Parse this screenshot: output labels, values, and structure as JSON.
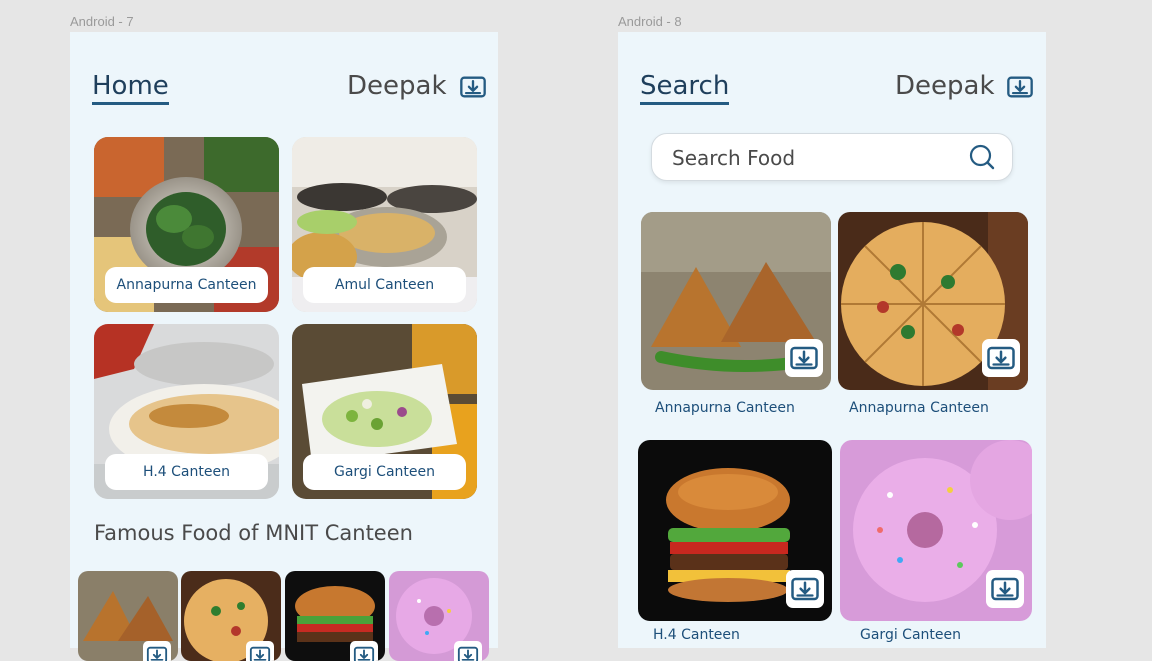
{
  "frames": {
    "left_label": "Android - 7",
    "right_label": "Android - 8"
  },
  "home": {
    "title": "Home",
    "user": "Deepak",
    "icon": "download-icon",
    "canteens": [
      {
        "label": "Annapurna Canteen",
        "image": "food-platter"
      },
      {
        "label": "Amul Canteen",
        "image": "buffet-trays"
      },
      {
        "label": "H.4 Canteen",
        "image": "baked-dish"
      },
      {
        "label": "Gargi Canteen",
        "image": "chopped-salad"
      }
    ],
    "section_title": "Famous Food of MNIT Canteen",
    "famous_foods": [
      {
        "image": "samosa"
      },
      {
        "image": "pizza"
      },
      {
        "image": "burger"
      },
      {
        "image": "donut"
      }
    ]
  },
  "search": {
    "title": "Search",
    "user": "Deepak",
    "icon": "download-icon",
    "placeholder": "Search Food",
    "results": [
      {
        "label": "Annapurna Canteen",
        "image": "samosa"
      },
      {
        "label": "Annapurna Canteen",
        "image": "pizza"
      },
      {
        "label": "H.4 Canteen",
        "image": "burger"
      },
      {
        "label": "Gargi Canteen",
        "image": "donut"
      }
    ]
  },
  "colors": {
    "screen_bg": "#edf6fb",
    "canvas_bg": "#e6e6e6",
    "accent": "#245b82",
    "label_text": "#1d4f7a"
  }
}
